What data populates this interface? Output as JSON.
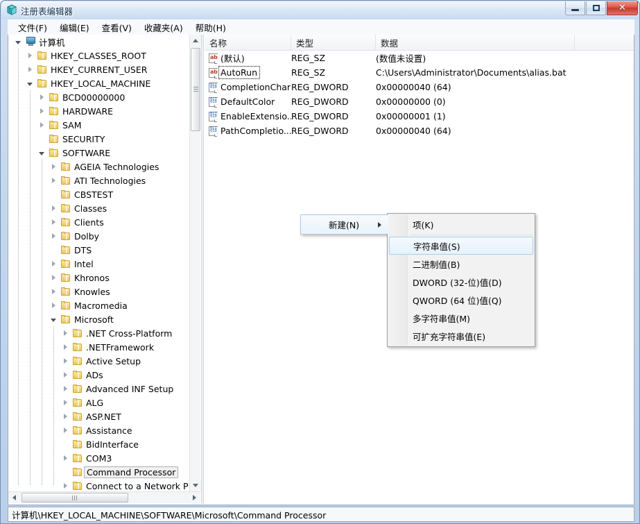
{
  "window": {
    "title": "注册表编辑器",
    "icon": "registry-editor-icon",
    "buttons": {
      "minimize": "–",
      "maximize": "□",
      "close": "✕"
    }
  },
  "menubar": {
    "items": [
      {
        "label": "文件(F)",
        "name": "menu-file"
      },
      {
        "label": "编辑(E)",
        "name": "menu-edit"
      },
      {
        "label": "查看(V)",
        "name": "menu-view"
      },
      {
        "label": "收藏夹(A)",
        "name": "menu-favorites"
      },
      {
        "label": "帮助(H)",
        "name": "menu-help"
      }
    ]
  },
  "tree": {
    "nodes": [
      {
        "label": "计算机",
        "depth": 0,
        "arrow": "expanded",
        "icon": "computer-icon",
        "selected": false
      },
      {
        "label": "HKEY_CLASSES_ROOT",
        "depth": 1,
        "arrow": "collapsed",
        "icon": "folder-icon",
        "selected": false
      },
      {
        "label": "HKEY_CURRENT_USER",
        "depth": 1,
        "arrow": "collapsed",
        "icon": "folder-icon",
        "selected": false
      },
      {
        "label": "HKEY_LOCAL_MACHINE",
        "depth": 1,
        "arrow": "expanded",
        "icon": "folder-icon",
        "selected": false
      },
      {
        "label": "BCD00000000",
        "depth": 2,
        "arrow": "collapsed",
        "icon": "folder-icon",
        "selected": false
      },
      {
        "label": "HARDWARE",
        "depth": 2,
        "arrow": "collapsed",
        "icon": "folder-icon",
        "selected": false
      },
      {
        "label": "SAM",
        "depth": 2,
        "arrow": "collapsed",
        "icon": "folder-icon",
        "selected": false
      },
      {
        "label": "SECURITY",
        "depth": 2,
        "arrow": "none",
        "icon": "folder-icon",
        "selected": false
      },
      {
        "label": "SOFTWARE",
        "depth": 2,
        "arrow": "expanded",
        "icon": "folder-icon",
        "selected": false
      },
      {
        "label": "AGEIA Technologies",
        "depth": 3,
        "arrow": "collapsed",
        "icon": "folder-icon",
        "selected": false
      },
      {
        "label": "ATI Technologies",
        "depth": 3,
        "arrow": "collapsed",
        "icon": "folder-icon",
        "selected": false
      },
      {
        "label": "CBSTEST",
        "depth": 3,
        "arrow": "none",
        "icon": "folder-icon",
        "selected": false
      },
      {
        "label": "Classes",
        "depth": 3,
        "arrow": "collapsed",
        "icon": "folder-icon",
        "selected": false
      },
      {
        "label": "Clients",
        "depth": 3,
        "arrow": "collapsed",
        "icon": "folder-icon",
        "selected": false
      },
      {
        "label": "Dolby",
        "depth": 3,
        "arrow": "collapsed",
        "icon": "folder-icon",
        "selected": false
      },
      {
        "label": "DTS",
        "depth": 3,
        "arrow": "none",
        "icon": "folder-icon",
        "selected": false
      },
      {
        "label": "Intel",
        "depth": 3,
        "arrow": "collapsed",
        "icon": "folder-icon",
        "selected": false
      },
      {
        "label": "Khronos",
        "depth": 3,
        "arrow": "collapsed",
        "icon": "folder-icon",
        "selected": false
      },
      {
        "label": "Knowles",
        "depth": 3,
        "arrow": "collapsed",
        "icon": "folder-icon",
        "selected": false
      },
      {
        "label": "Macromedia",
        "depth": 3,
        "arrow": "collapsed",
        "icon": "folder-icon",
        "selected": false
      },
      {
        "label": "Microsoft",
        "depth": 3,
        "arrow": "expanded",
        "icon": "folder-icon",
        "selected": false
      },
      {
        "label": ".NET Cross-Platform",
        "depth": 4,
        "arrow": "collapsed",
        "icon": "folder-icon",
        "selected": false
      },
      {
        "label": ".NETFramework",
        "depth": 4,
        "arrow": "collapsed",
        "icon": "folder-icon",
        "selected": false
      },
      {
        "label": "Active Setup",
        "depth": 4,
        "arrow": "collapsed",
        "icon": "folder-icon",
        "selected": false
      },
      {
        "label": "ADs",
        "depth": 4,
        "arrow": "collapsed",
        "icon": "folder-icon",
        "selected": false
      },
      {
        "label": "Advanced INF Setup",
        "depth": 4,
        "arrow": "collapsed",
        "icon": "folder-icon",
        "selected": false
      },
      {
        "label": "ALG",
        "depth": 4,
        "arrow": "collapsed",
        "icon": "folder-icon",
        "selected": false
      },
      {
        "label": "ASP.NET",
        "depth": 4,
        "arrow": "collapsed",
        "icon": "folder-icon",
        "selected": false
      },
      {
        "label": "Assistance",
        "depth": 4,
        "arrow": "collapsed",
        "icon": "folder-icon",
        "selected": false
      },
      {
        "label": "BidInterface",
        "depth": 4,
        "arrow": "none",
        "icon": "folder-icon",
        "selected": false
      },
      {
        "label": "COM3",
        "depth": 4,
        "arrow": "collapsed",
        "icon": "folder-icon",
        "selected": false
      },
      {
        "label": "Command Processor",
        "depth": 4,
        "arrow": "none",
        "icon": "folder-icon",
        "selected": true
      },
      {
        "label": "Connect to a Network P",
        "depth": 4,
        "arrow": "collapsed",
        "icon": "folder-icon",
        "selected": false
      }
    ]
  },
  "list": {
    "columns": [
      {
        "label": "名称",
        "name": "column-name"
      },
      {
        "label": "类型",
        "name": "column-type"
      },
      {
        "label": "数据",
        "name": "column-data"
      }
    ],
    "rows": [
      {
        "name": "(默认)",
        "type": "REG_SZ",
        "data": "(数值未设置)",
        "icon": "string-value-icon",
        "focused": false
      },
      {
        "name": "AutoRun",
        "type": "REG_SZ",
        "data": "C:\\Users\\Administrator\\Documents\\alias.bat",
        "icon": "string-value-icon",
        "focused": true
      },
      {
        "name": "CompletionChar",
        "type": "REG_DWORD",
        "data": "0x00000040 (64)",
        "icon": "dword-value-icon",
        "focused": false
      },
      {
        "name": "DefaultColor",
        "type": "REG_DWORD",
        "data": "0x00000000 (0)",
        "icon": "dword-value-icon",
        "focused": false
      },
      {
        "name": "EnableExtensio...",
        "type": "REG_DWORD",
        "data": "0x00000001 (1)",
        "icon": "dword-value-icon",
        "focused": false
      },
      {
        "name": "PathCompletio...",
        "type": "REG_DWORD",
        "data": "0x00000040 (64)",
        "icon": "dword-value-icon",
        "focused": false
      }
    ]
  },
  "context_menu": {
    "parent": {
      "label": "新建(N)",
      "has_submenu": true
    },
    "submenu": [
      {
        "label": "项(K)",
        "highlight": false,
        "separator_after": true
      },
      {
        "label": "字符串值(S)",
        "highlight": true,
        "separator_after": false
      },
      {
        "label": "二进制值(B)",
        "highlight": false,
        "separator_after": false
      },
      {
        "label": "DWORD (32-位)值(D)",
        "highlight": false,
        "separator_after": false
      },
      {
        "label": "QWORD (64 位)值(Q)",
        "highlight": false,
        "separator_after": false
      },
      {
        "label": "多字符串值(M)",
        "highlight": false,
        "separator_after": false
      },
      {
        "label": "可扩充字符串值(E)",
        "highlight": false,
        "separator_after": false
      }
    ]
  },
  "statusbar": {
    "path": "计算机\\HKEY_LOCAL_MACHINE\\SOFTWARE\\Microsoft\\Command Processor"
  },
  "colors": {
    "title_text": "#15304f",
    "close_button": "#c63a2c",
    "folder": "#e8c95e",
    "string_icon": "#c0392b",
    "dword_icon": "#1f5fbf",
    "highlight_border": "#a8cfeb"
  }
}
